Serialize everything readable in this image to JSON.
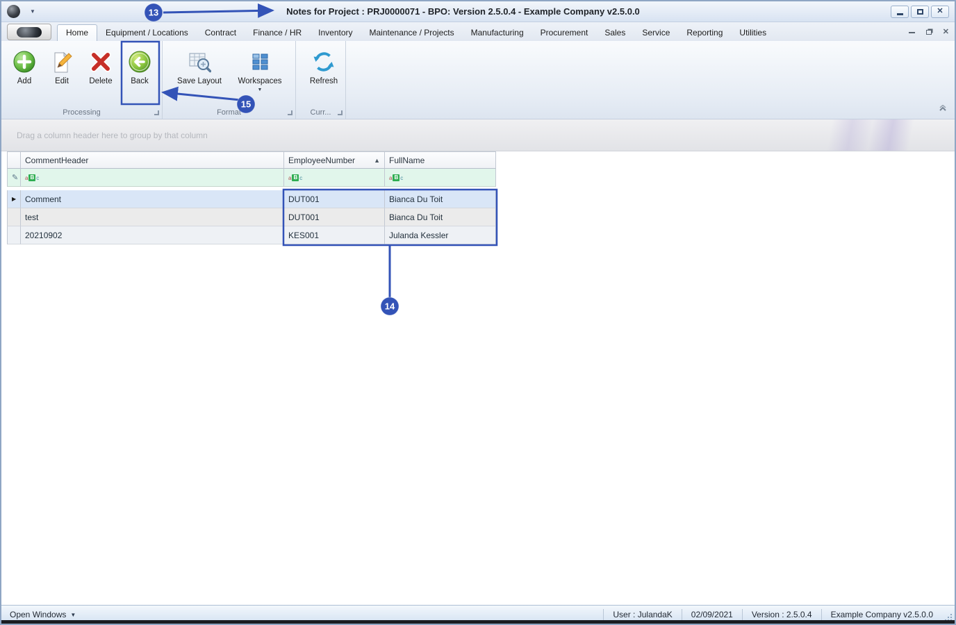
{
  "titlebar": {
    "title": "Notes for Project : PRJ0000071 - BPO: Version 2.5.0.4 - Example Company v2.5.0.0"
  },
  "ribbon": {
    "tabs": [
      {
        "label": "Home"
      },
      {
        "label": "Equipment / Locations"
      },
      {
        "label": "Contract"
      },
      {
        "label": "Finance / HR"
      },
      {
        "label": "Inventory"
      },
      {
        "label": "Maintenance / Projects"
      },
      {
        "label": "Manufacturing"
      },
      {
        "label": "Procurement"
      },
      {
        "label": "Sales"
      },
      {
        "label": "Service"
      },
      {
        "label": "Reporting"
      },
      {
        "label": "Utilities"
      }
    ],
    "groups": [
      {
        "label": "Processing",
        "buttons": [
          {
            "label": "Add"
          },
          {
            "label": "Edit"
          },
          {
            "label": "Delete"
          },
          {
            "label": "Back"
          }
        ]
      },
      {
        "label": "Format",
        "buttons": [
          {
            "label": "Save Layout"
          },
          {
            "label": "Workspaces"
          }
        ]
      },
      {
        "label": "Curr...",
        "buttons": [
          {
            "label": "Refresh"
          }
        ]
      }
    ]
  },
  "grid": {
    "group_hint": "Drag a column header here to group by that column",
    "columns": [
      "CommentHeader",
      "EmployeeNumber",
      "FullName"
    ],
    "sort": {
      "column": "EmployeeNumber",
      "direction": "ascending"
    },
    "rows": [
      [
        "Comment",
        "DUT001",
        "Bianca Du Toit"
      ],
      [
        "test",
        "DUT001",
        "Bianca Du Toit"
      ],
      [
        "20210902",
        "KES001",
        "Julanda Kessler"
      ]
    ]
  },
  "statusbar": {
    "open_windows": "Open Windows",
    "user": "User : JulandaK",
    "date": "02/09/2021",
    "version": "Version : 2.5.0.4",
    "company": "Example Company v2.5.0.0"
  },
  "annotations": {
    "n13": "13",
    "n14": "14",
    "n15": "15"
  },
  "icons": {
    "dropdown": "▼",
    "sort_ascending": "▲",
    "row_indicator": "▶",
    "close": "✕",
    "filter_row": "✎",
    "abc_a": "a",
    "abc_b": "B",
    "abc_c": "c"
  },
  "colors": {
    "annotation": "#3353b7",
    "selected_row": "#d9e6f7",
    "filter_row": "#e1f6eb",
    "add_green": "#4ca83d",
    "delete_red": "#c62f28",
    "workspaces_blue": "#4f8fd0"
  }
}
